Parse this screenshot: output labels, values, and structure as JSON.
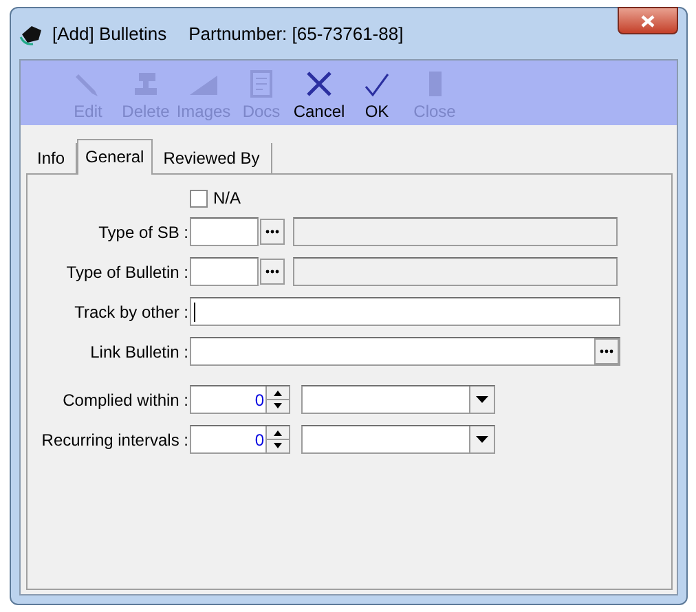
{
  "window": {
    "title": "[Add] Bulletins",
    "subtitle": "Partnumber: [65-73761-88]"
  },
  "toolbar": [
    {
      "kind": "edit",
      "label": "Edit",
      "disabled": true
    },
    {
      "kind": "delete",
      "label": "Delete",
      "disabled": true
    },
    {
      "kind": "images",
      "label": "Images",
      "disabled": true
    },
    {
      "kind": "docs",
      "label": "Docs",
      "disabled": true
    },
    {
      "kind": "cancel",
      "label": "Cancel",
      "disabled": false
    },
    {
      "kind": "ok",
      "label": "OK",
      "disabled": false
    },
    {
      "kind": "close",
      "label": "Close",
      "disabled": true
    }
  ],
  "tabs": [
    {
      "label": "Info",
      "selected": false
    },
    {
      "label": "General",
      "selected": true
    },
    {
      "label": "Reviewed By",
      "selected": false
    }
  ],
  "na_checkbox": {
    "label": "N/A",
    "checked": false
  },
  "fields": [
    {
      "kind": "lookup",
      "label": "Type of SB :"
    },
    {
      "kind": "lookup",
      "label": "Type of Bulletin :"
    },
    {
      "kind": "text",
      "label": "Track by other :"
    },
    {
      "kind": "browse",
      "label": "Link Bulletin :"
    },
    {
      "kind": "spin",
      "label": "Complied within :",
      "value": "0"
    },
    {
      "kind": "spin",
      "label": "Recurring intervals :",
      "value": "0"
    }
  ]
}
